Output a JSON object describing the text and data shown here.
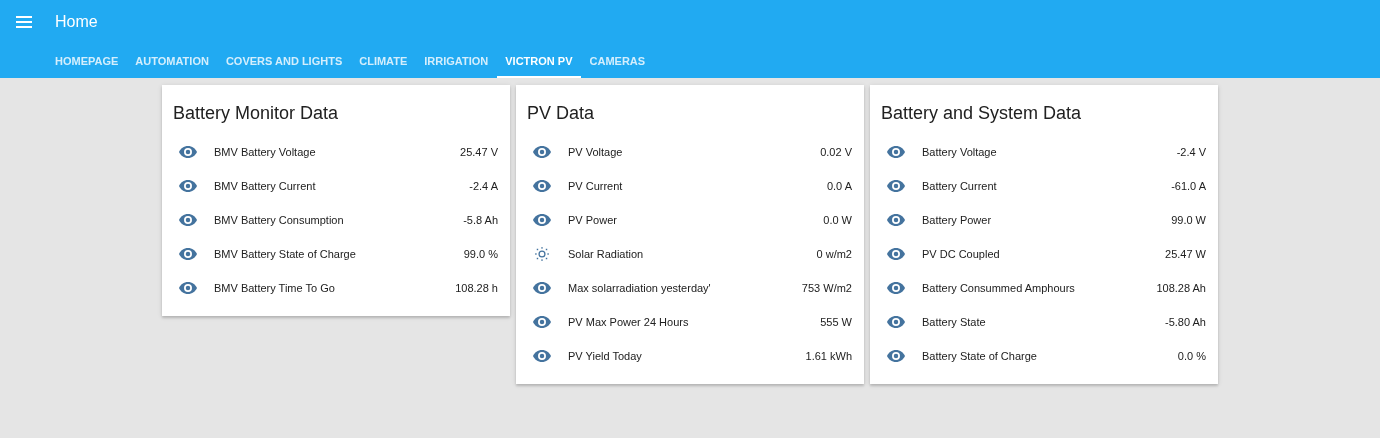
{
  "app_bar": {
    "title": "Home"
  },
  "tabs": [
    {
      "label": "HOMEPAGE",
      "selected": false
    },
    {
      "label": "AUTOMATION",
      "selected": false
    },
    {
      "label": "COVERS AND LIGHTS",
      "selected": false
    },
    {
      "label": "CLIMATE",
      "selected": false
    },
    {
      "label": "IRRIGATION",
      "selected": false
    },
    {
      "label": "VICTRON PV",
      "selected": true
    },
    {
      "label": "CAMERAS",
      "selected": false
    }
  ],
  "cards": [
    {
      "title": "Battery Monitor Data",
      "rows": [
        {
          "kind": "eye",
          "label": "BMV Battery Voltage",
          "value": "25.47 V"
        },
        {
          "kind": "eye",
          "label": "BMV Battery Current",
          "value": "-2.4 A"
        },
        {
          "kind": "eye",
          "label": "BMV Battery Consumption",
          "value": "-5.8 Ah"
        },
        {
          "kind": "eye",
          "label": "BMV Battery State of Charge",
          "value": "99.0 %"
        },
        {
          "kind": "eye",
          "label": "BMV Battery Time To Go",
          "value": "108.28 h"
        }
      ]
    },
    {
      "title": "PV Data",
      "rows": [
        {
          "kind": "eye",
          "label": "PV Voltage",
          "value": "0.02 V"
        },
        {
          "kind": "eye",
          "label": "PV Current",
          "value": "0.0 A"
        },
        {
          "kind": "eye",
          "label": "PV Power",
          "value": "0.0 W"
        },
        {
          "kind": "sun",
          "label": "Solar Radiation",
          "value": "0 w/m2"
        },
        {
          "kind": "eye",
          "label": "Max solarradiation yesterday'",
          "value": "753 W/m2"
        },
        {
          "kind": "eye",
          "label": "PV Max Power 24 Hours",
          "value": "555 W"
        },
        {
          "kind": "eye",
          "label": "PV Yield Today",
          "value": "1.61 kWh"
        }
      ]
    },
    {
      "title": "Battery and System Data",
      "rows": [
        {
          "kind": "eye",
          "label": "Battery Voltage",
          "value": "-2.4 V"
        },
        {
          "kind": "eye",
          "label": "Battery Current",
          "value": "-61.0 A"
        },
        {
          "kind": "eye",
          "label": "Battery Power",
          "value": "99.0 W"
        },
        {
          "kind": "eye",
          "label": "PV DC Coupled",
          "value": "25.47 W"
        },
        {
          "kind": "eye",
          "label": "Battery Consummed Amphours",
          "value": "108.28 Ah"
        },
        {
          "kind": "eye",
          "label": "Battery State",
          "value": "-5.80 Ah"
        },
        {
          "kind": "eye",
          "label": "Battery State of Charge",
          "value": "0.0 %"
        }
      ]
    }
  ]
}
